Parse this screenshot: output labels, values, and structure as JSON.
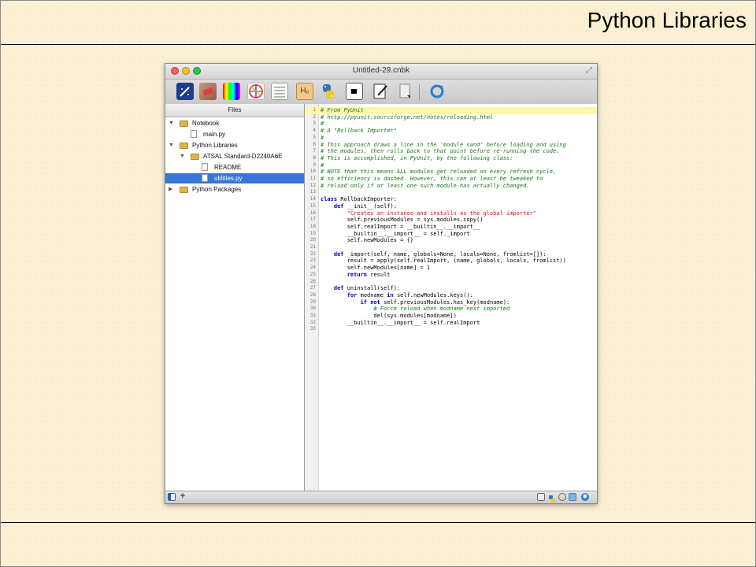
{
  "slide": {
    "title": "Python Libraries"
  },
  "window": {
    "title": "Untitled-29.cnbk",
    "toolbar_icons": [
      "telescope-icon",
      "tag-icon",
      "spectrum-icon",
      "color-wheel-icon",
      "table-icon",
      "header-h0-icon",
      "python-icon",
      "terminal-icon",
      "notebook-edit-icon",
      "page-icon",
      "refresh-icon"
    ]
  },
  "sidebar": {
    "header": "Files",
    "items": [
      {
        "label": "Notebook",
        "type": "folder",
        "level": 0,
        "expanded": true
      },
      {
        "label": "main.py",
        "type": "file",
        "level": 1
      },
      {
        "label": "Python Libraries",
        "type": "folder",
        "level": 0,
        "expanded": true
      },
      {
        "label": "ATSAL Standard-D2240A6E",
        "type": "folder",
        "level": 1,
        "expanded": true
      },
      {
        "label": "README",
        "type": "file",
        "level": 2
      },
      {
        "label": "ublities.py",
        "type": "file",
        "level": 2,
        "selected": true
      },
      {
        "label": "Python Packages",
        "type": "folder",
        "level": 0,
        "expanded": false
      }
    ]
  },
  "editor": {
    "highlight_line": 1,
    "lines": [
      [
        {
          "t": "# From PyUnit",
          "c": "comment"
        }
      ],
      [
        {
          "t": "# http://pyunit.sourceforge.net/notes/reloading.html",
          "c": "comment"
        }
      ],
      [
        {
          "t": "#",
          "c": "comment"
        }
      ],
      [
        {
          "t": "# A \"Rollback Importer\"",
          "c": "comment"
        }
      ],
      [
        {
          "t": "#",
          "c": "comment"
        }
      ],
      [
        {
          "t": "# This approach draws a line in the 'module sand' before loading and using",
          "c": "comment"
        }
      ],
      [
        {
          "t": "# the modules, then rolls back to that point before re-running the code.",
          "c": "comment"
        }
      ],
      [
        {
          "t": "# This is accomplished, in PyUnit, by the following class:",
          "c": "comment"
        }
      ],
      [
        {
          "t": "#",
          "c": "comment"
        }
      ],
      [
        {
          "t": "# NOTE that this means ALL modules get reloaded on every refresh cycle,",
          "c": "comment"
        }
      ],
      [
        {
          "t": "# so efficiency is dashed. However, this can at least be tweaked to",
          "c": "comment"
        }
      ],
      [
        {
          "t": "# reload only if at least one such module has actually changed.",
          "c": "comment"
        }
      ],
      [],
      [
        {
          "t": "class ",
          "c": "kw"
        },
        {
          "t": "RollbackImporter:",
          "c": "default"
        }
      ],
      [
        {
          "t": "    ",
          "c": "default"
        },
        {
          "t": "def ",
          "c": "kw"
        },
        {
          "t": "__init__(self):",
          "c": "default"
        }
      ],
      [
        {
          "t": "        \"Creates an instance and installs as the global importer\"",
          "c": "string"
        }
      ],
      [
        {
          "t": "        self.previousModules = sys.modules.copy()",
          "c": "default"
        }
      ],
      [
        {
          "t": "        self.realImport = __builtin__.__import__",
          "c": "default"
        }
      ],
      [
        {
          "t": "        __builtin__.__import__ = self._import",
          "c": "default"
        }
      ],
      [
        {
          "t": "        self.newModules = {}",
          "c": "default"
        }
      ],
      [],
      [
        {
          "t": "    ",
          "c": "default"
        },
        {
          "t": "def ",
          "c": "kw"
        },
        {
          "t": "_import(self, name, globals=None, locals=None, fromlist=[]):",
          "c": "default"
        }
      ],
      [
        {
          "t": "        result = apply(self.realImport, (name, globals, locals, fromlist))",
          "c": "default"
        }
      ],
      [
        {
          "t": "        self.newModules[name] = 1",
          "c": "default"
        }
      ],
      [
        {
          "t": "        ",
          "c": "default"
        },
        {
          "t": "return ",
          "c": "kw"
        },
        {
          "t": "result",
          "c": "default"
        }
      ],
      [],
      [
        {
          "t": "    ",
          "c": "default"
        },
        {
          "t": "def ",
          "c": "kw"
        },
        {
          "t": "uninstall(self):",
          "c": "default"
        }
      ],
      [
        {
          "t": "        ",
          "c": "default"
        },
        {
          "t": "for ",
          "c": "kw"
        },
        {
          "t": "modname ",
          "c": "default"
        },
        {
          "t": "in ",
          "c": "kw"
        },
        {
          "t": "self.newModules.keys():",
          "c": "default"
        }
      ],
      [
        {
          "t": "            ",
          "c": "default"
        },
        {
          "t": "if not ",
          "c": "kw"
        },
        {
          "t": "self.previousModules.has_key(modname):",
          "c": "default"
        }
      ],
      [
        {
          "t": "                # Force reload when modname next imported",
          "c": "comment"
        }
      ],
      [
        {
          "t": "                del(sys.modules[modname])",
          "c": "default"
        }
      ],
      [
        {
          "t": "        __builtin__.__import__ = self.realImport",
          "c": "default"
        }
      ],
      []
    ]
  }
}
